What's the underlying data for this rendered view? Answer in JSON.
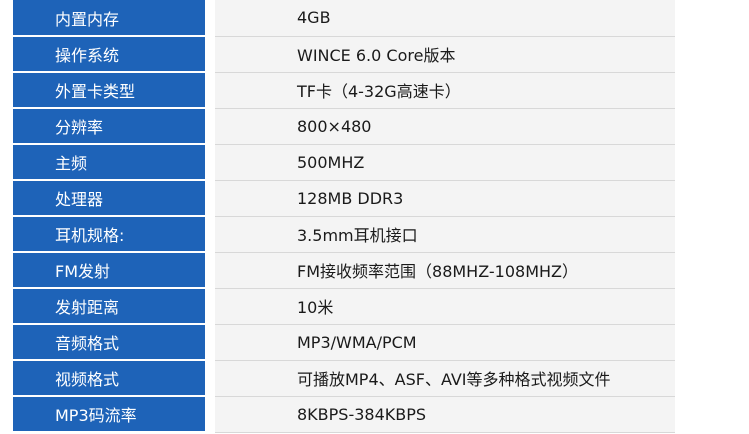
{
  "specs": [
    {
      "label": "内置内存",
      "value": "4GB"
    },
    {
      "label": "操作系统",
      "value": "WINCE 6.0 Core版本"
    },
    {
      "label": "外置卡类型",
      "value": "TF卡（4-32G高速卡）"
    },
    {
      "label": "分辨率",
      "value": "800×480"
    },
    {
      "label": "主频",
      "value": "500MHZ"
    },
    {
      "label": "处理器",
      "value": "128MB DDR3"
    },
    {
      "label": "耳机规格:",
      "value": "3.5mm耳机接口"
    },
    {
      "label": "FM发射",
      "value": "FM接收频率范围（88MHZ-108MHZ）"
    },
    {
      "label": "发射距离",
      "value": "10米"
    },
    {
      "label": "音频格式",
      "value": "MP3/WMA/PCM"
    },
    {
      "label": "视频格式",
      "value": "可播放MP4、ASF、AVI等多种格式视频文件"
    },
    {
      "label": "MP3码流率",
      "value": "8KBPS-384KBPS"
    }
  ],
  "colors": {
    "label_bg": "#1e63b8",
    "value_bg": "#f4f4f4"
  }
}
